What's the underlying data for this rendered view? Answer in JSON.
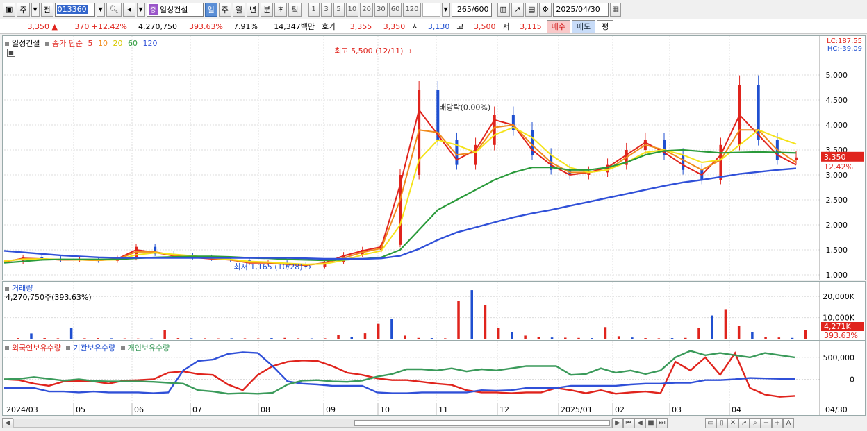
{
  "toolbar": {
    "market": "주",
    "prev": "전",
    "code": "013360",
    "name_tag": "증",
    "name": "일성건설",
    "periods": [
      "일",
      "주",
      "월",
      "년",
      "분",
      "초",
      "틱"
    ],
    "active_period": "일",
    "intervals": [
      "1",
      "3",
      "5",
      "10",
      "20",
      "30",
      "60",
      "120"
    ],
    "count": "265",
    "count_max": "/600",
    "date": "2025/04/30"
  },
  "quote": {
    "price": "3,350",
    "change": "370",
    "change_pct": "+12.42%",
    "volume": "4,270,750",
    "vol_ratio": "393.63%",
    "turnover": "7.91%",
    "amount": "14,347백만",
    "hoga_label": "호가",
    "ask": "3,355",
    "bid": "3,350",
    "open_label": "시",
    "open": "3,130",
    "high_label": "고",
    "high": "3,500",
    "low_label": "저",
    "low": "3,115",
    "buy_label": "매수",
    "sell_label": "매도",
    "even_label": "평"
  },
  "price_panel": {
    "legend_name": "일성건설",
    "legend_ma": "종가 단순",
    "ma_labels": [
      "5",
      "10",
      "20",
      "60",
      "120"
    ],
    "lc": "LC:187.55",
    "hc": "HC:-39.09",
    "price_tag": "3,350",
    "pct_tag": "12.42%",
    "high_note": "최고 5,500 (12/11)",
    "low_note": "최저 1,165 (10/28)",
    "div_note": "배당락(0.00%)"
  },
  "volume_panel": {
    "title": "거래량",
    "value": "4,270,750주(393.63%)",
    "tag": "4,271K",
    "pct_tag": "393.63%"
  },
  "holding_panel": {
    "legend": [
      "외국인보유수량",
      "기관보유수량",
      "개인보유수량"
    ]
  },
  "colors": {
    "up": "#e0241d",
    "down": "#1f4fd0",
    "ma5": "#e0241d",
    "ma10": "#f08a1c",
    "ma20": "#f5e31a",
    "ma60": "#2a9a3a",
    "ma120": "#3050d8",
    "foreign": "#e0241d",
    "inst": "#3050d8",
    "indiv": "#3a9a5a"
  },
  "chart_data": [
    {
      "type": "candlestick",
      "title": "일성건설",
      "x": [
        "2024/03",
        "05",
        "06",
        "07",
        "08",
        "09",
        "10",
        "11",
        "12",
        "2025/01",
        "02",
        "03",
        "04",
        "04/30"
      ],
      "ylim": [
        1000,
        5500
      ],
      "yticks": [
        "1,000",
        "1,500",
        "2,000",
        "2,500",
        "3,000",
        "3,500",
        "4,000",
        "4,500",
        "5,000"
      ],
      "yticks_values": [
        1000,
        1500,
        2000,
        2500,
        3000,
        3500,
        4000,
        4500,
        5000
      ],
      "series": [
        {
          "name": "종가",
          "values": [
            1250,
            1350,
            1320,
            1290,
            1300,
            1280,
            1330,
            1560,
            1420,
            1380,
            1350,
            1320,
            1300,
            1230,
            1240,
            1200,
            1165,
            1250,
            1400,
            1500,
            1600,
            3000,
            4700,
            3700,
            3200,
            3600,
            4200,
            3900,
            3400,
            3100,
            3000,
            3050,
            3200,
            3500,
            3700,
            3400,
            3100,
            2900,
            3600,
            4800,
            3700,
            3300,
            3350
          ]
        },
        {
          "name": "5",
          "values": [
            1260,
            1330,
            1320,
            1300,
            1300,
            1290,
            1320,
            1500,
            1450,
            1380,
            1350,
            1320,
            1300,
            1240,
            1240,
            1210,
            1190,
            1240,
            1380,
            1480,
            1560,
            2800,
            4300,
            3800,
            3300,
            3500,
            4100,
            4000,
            3500,
            3200,
            3000,
            3050,
            3150,
            3400,
            3650,
            3450,
            3200,
            3000,
            3400,
            4200,
            3800,
            3400,
            3200
          ]
        },
        {
          "name": "10",
          "values": [
            1270,
            1320,
            1320,
            1300,
            1300,
            1290,
            1310,
            1460,
            1460,
            1390,
            1360,
            1330,
            1300,
            1250,
            1245,
            1215,
            1200,
            1230,
            1340,
            1450,
            1530,
            2500,
            3900,
            3850,
            3400,
            3450,
            3950,
            4000,
            3600,
            3250,
            3050,
            3050,
            3100,
            3350,
            3600,
            3500,
            3300,
            3100,
            3300,
            3900,
            3900,
            3500,
            3250
          ]
        },
        {
          "name": "20",
          "values": [
            1280,
            1310,
            1320,
            1310,
            1300,
            1300,
            1300,
            1400,
            1440,
            1410,
            1380,
            1340,
            1310,
            1270,
            1255,
            1230,
            1210,
            1220,
            1290,
            1400,
            1480,
            2000,
            3300,
            3700,
            3600,
            3450,
            3800,
            3950,
            3750,
            3400,
            3150,
            3050,
            3100,
            3250,
            3450,
            3500,
            3400,
            3250,
            3300,
            3600,
            3900,
            3750,
            3620
          ]
        },
        {
          "name": "60",
          "values": [
            1240,
            1270,
            1300,
            1310,
            1310,
            1310,
            1310,
            1330,
            1350,
            1360,
            1370,
            1370,
            1360,
            1340,
            1330,
            1310,
            1300,
            1290,
            1300,
            1320,
            1350,
            1500,
            1900,
            2300,
            2500,
            2700,
            2900,
            3050,
            3150,
            3150,
            3100,
            3100,
            3150,
            3250,
            3400,
            3480,
            3500,
            3470,
            3440,
            3450,
            3460,
            3450,
            3440
          ]
        },
        {
          "name": "120",
          "values": [
            1480,
            1450,
            1420,
            1390,
            1370,
            1350,
            1340,
            1340,
            1340,
            1340,
            1340,
            1340,
            1340,
            1340,
            1340,
            1340,
            1330,
            1320,
            1320,
            1320,
            1330,
            1380,
            1520,
            1700,
            1850,
            1950,
            2050,
            2150,
            2230,
            2300,
            2380,
            2460,
            2540,
            2620,
            2700,
            2780,
            2850,
            2900,
            2960,
            3020,
            3060,
            3100,
            3130
          ]
        }
      ],
      "high_point": {
        "label": "최고 5,500 (12/11)",
        "value": 5500
      },
      "low_point": {
        "label": "최저 1,165 (10/28)",
        "value": 1165
      }
    },
    {
      "type": "bar",
      "title": "거래량",
      "ylim": [
        0,
        25000
      ],
      "yticks": [
        "10,000K",
        "20,000K"
      ],
      "yticks_values": [
        10000,
        20000
      ],
      "values": [
        300,
        2500,
        300,
        200,
        5000,
        200,
        300,
        200,
        150,
        100,
        120,
        4200,
        300,
        200,
        200,
        150,
        200,
        180,
        150,
        300,
        400,
        200,
        150,
        200,
        1800,
        800,
        2600,
        7000,
        9500,
        1500,
        400,
        300,
        200,
        18000,
        23000,
        16000,
        5000,
        3000,
        1500,
        800,
        600,
        500,
        400,
        300,
        5500,
        1200,
        600,
        300,
        200,
        300,
        400,
        5000,
        11000,
        14000,
        6000,
        3000,
        800,
        600,
        400,
        4271
      ]
    },
    {
      "type": "line",
      "title": "보유수량",
      "ylim": [
        -500000,
        800000
      ],
      "yticks": [
        "0",
        "500,000"
      ],
      "yticks_values": [
        0,
        500000
      ],
      "series": [
        {
          "name": "외국인보유수량",
          "values": [
            0,
            -20000,
            -100000,
            -150000,
            -50000,
            -40000,
            -50000,
            -100000,
            -30000,
            -20000,
            0,
            150000,
            180000,
            120000,
            100000,
            -120000,
            -250000,
            100000,
            300000,
            400000,
            430000,
            420000,
            300000,
            150000,
            100000,
            20000,
            -20000,
            -20000,
            -60000,
            -100000,
            -130000,
            -250000,
            -300000,
            -300000,
            -320000,
            -300000,
            -300000,
            -200000,
            -250000,
            -320000,
            -250000,
            -330000,
            -300000,
            -280000,
            -320000,
            400000,
            200000,
            500000,
            100000,
            600000,
            -200000,
            -350000,
            -400000,
            -380000
          ]
        },
        {
          "name": "기관보유수량",
          "values": [
            -200000,
            -200000,
            -200000,
            -280000,
            -280000,
            -300000,
            -280000,
            -300000,
            -300000,
            -300000,
            -320000,
            -300000,
            200000,
            420000,
            450000,
            580000,
            620000,
            600000,
            300000,
            -50000,
            -100000,
            -120000,
            -150000,
            -150000,
            -150000,
            -300000,
            -320000,
            -320000,
            -300000,
            -300000,
            -300000,
            -300000,
            -250000,
            -260000,
            -250000,
            -200000,
            -200000,
            -200000,
            -150000,
            -150000,
            -150000,
            -150000,
            -120000,
            -100000,
            -100000,
            -80000,
            -80000,
            -20000,
            -20000,
            0,
            30000,
            20000,
            10000,
            10000
          ]
        },
        {
          "name": "개인보유수량",
          "values": [
            0,
            10000,
            50000,
            10000,
            -30000,
            0,
            -40000,
            -50000,
            -50000,
            -50000,
            -60000,
            -80000,
            -100000,
            -250000,
            -280000,
            -330000,
            -320000,
            -330000,
            -310000,
            -120000,
            -30000,
            -20000,
            -50000,
            -60000,
            -30000,
            60000,
            120000,
            230000,
            230000,
            200000,
            250000,
            180000,
            230000,
            200000,
            250000,
            300000,
            300000,
            300000,
            100000,
            120000,
            250000,
            150000,
            200000,
            120000,
            200000,
            500000,
            650000,
            550000,
            600000,
            550000,
            500000,
            600000,
            550000,
            500000
          ]
        }
      ]
    }
  ]
}
